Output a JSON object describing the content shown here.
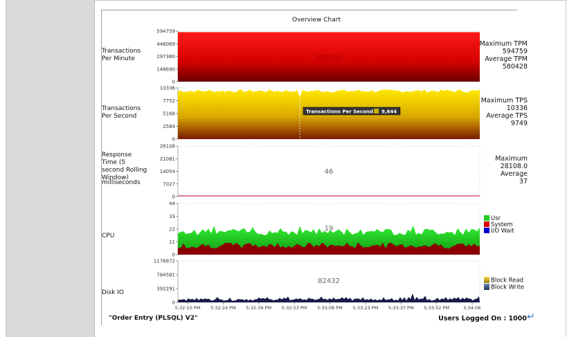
{
  "window": {
    "title": "Overview Chart"
  },
  "rows": [
    {
      "id": "tpm",
      "label_lines": [
        "Transactions",
        "Per Minute"
      ],
      "ticks": [
        "594759",
        "446069",
        "297380",
        "148690",
        "0"
      ],
      "center_value": "580508",
      "right": [
        "Maximum TPM",
        "594759",
        "Average TPM",
        "580428"
      ]
    },
    {
      "id": "tps",
      "label_lines": [
        "Transactions",
        "Per Second"
      ],
      "ticks": [
        "10336",
        "7752",
        "5168",
        "2584",
        "0"
      ],
      "center_value": "",
      "right": [
        "Maximum TPS",
        "10336",
        "Average TPS",
        "9749"
      ]
    },
    {
      "id": "resp",
      "label_lines": [
        "Response",
        "Time (5",
        "second Rolling",
        "Window)",
        "milliseconds"
      ],
      "ticks": [
        "28108",
        "21081",
        "14054",
        "7027",
        "0"
      ],
      "center_value": "46",
      "right": [
        "Maximum",
        "28108.0",
        "Average",
        "37"
      ]
    },
    {
      "id": "cpu",
      "label_lines": [
        "CPU"
      ],
      "ticks": [
        "44",
        "33",
        "22",
        "11",
        "0"
      ],
      "center_value": "19",
      "legend": [
        {
          "name": "Usr",
          "color": "#22cc22"
        },
        {
          "name": "System",
          "color": "#dd0000"
        },
        {
          "name": "I/O Wait",
          "color": "#0000cc"
        }
      ]
    },
    {
      "id": "disk",
      "label_lines": [
        "Disk IO"
      ],
      "ticks": [
        "1176872",
        "784581",
        "392291",
        "0"
      ],
      "center_value": "82432",
      "legend": [
        {
          "name": "Block Read",
          "color": "#c8a020"
        },
        {
          "name": "Block Write",
          "color": "#3a5a8a"
        }
      ]
    }
  ],
  "tooltip": {
    "label": "Transactions Per Second",
    "value": "9,644"
  },
  "x_ticks": [
    "5:32:10 PM",
    "5:32:24 PM",
    "5:32:39 PM",
    "5:32:53 PM",
    "5:33:08 PM",
    "5:33:23 PM",
    "5:33:37 PM",
    "5:33:52 PM",
    "5:34:06"
  ],
  "footer": {
    "workload": "\"Order Entry (PLSQL) V2\"",
    "users": "Users Logged On : 1000"
  },
  "colors": {
    "tpm": "#dd0000",
    "tps": "#e6c000",
    "resp_line": "#d33366",
    "cpu_usr": "#22cc22",
    "cpu_sys": "#8b0000",
    "disk": "#1a1a4a"
  }
}
